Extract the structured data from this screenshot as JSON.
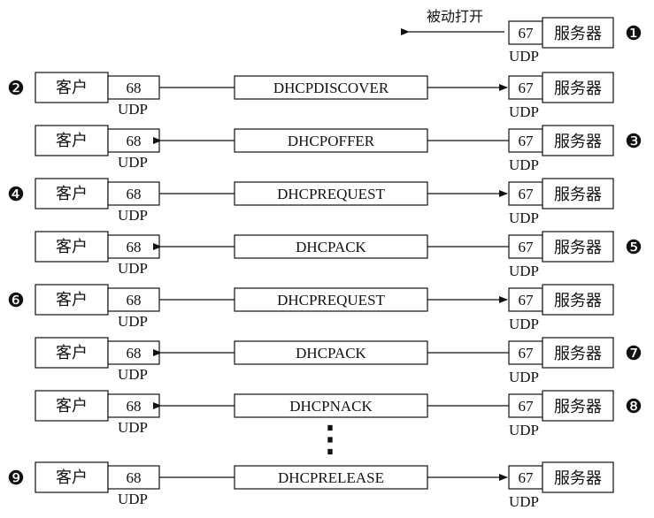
{
  "passive_open_label": "被动打开",
  "client_label": "客户",
  "server_label": "服务器",
  "client_port": "68",
  "server_port": "67",
  "transport": "UDP",
  "ellipsis": "⋮",
  "rows": [
    {
      "step": "❷",
      "step_side": "left",
      "message": "DHCPDISCOVER",
      "direction": "to-server"
    },
    {
      "step": "❸",
      "step_side": "right",
      "message": "DHCPOFFER",
      "direction": "to-client"
    },
    {
      "step": "❹",
      "step_side": "left",
      "message": "DHCPREQUEST",
      "direction": "to-server"
    },
    {
      "step": "❺",
      "step_side": "right",
      "message": "DHCPACK",
      "direction": "to-client"
    },
    {
      "step": "❻",
      "step_side": "left",
      "message": "DHCPREQUEST",
      "direction": "to-server"
    },
    {
      "step": "❼",
      "step_side": "right",
      "message": "DHCPACK",
      "direction": "to-client"
    },
    {
      "step": "❽",
      "step_side": "right",
      "message": "DHCPNACK",
      "direction": "to-client"
    },
    {
      "step": "❾",
      "step_side": "left",
      "message": "DHCPRELEASE",
      "direction": "to-server"
    }
  ],
  "top": {
    "step": "❶"
  }
}
